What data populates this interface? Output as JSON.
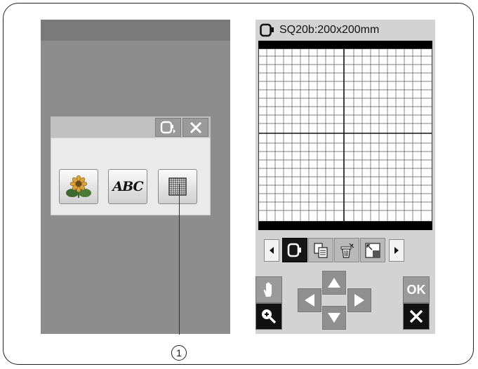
{
  "screen_right": {
    "title": "SQ20b:200x200mm",
    "title_icon": "hoop-icon"
  },
  "screen_left": {
    "dialog_header_icons": [
      "hoop-select-icon",
      "close-icon"
    ],
    "buttons": [
      {
        "name": "design-button",
        "icon": "flower-icon"
      },
      {
        "name": "lettering-button",
        "label": "ABC"
      },
      {
        "name": "grid-button",
        "icon": "grid-icon"
      }
    ]
  },
  "toolbar": {
    "items": [
      "hoop-icon",
      "copy-icon",
      "delete-icon",
      "resize-icon"
    ]
  },
  "navigation": {
    "hand": "hand-icon",
    "zoom": "zoom-in-icon",
    "arrows": [
      "up",
      "left",
      "right",
      "down"
    ],
    "ok_label": "OK",
    "cancel": "close-icon"
  },
  "callout": {
    "number": "1"
  },
  "colors": {
    "screen_gray": "#8d8d8d",
    "panel_gray": "#d3d3d3",
    "dark": "#161616"
  }
}
